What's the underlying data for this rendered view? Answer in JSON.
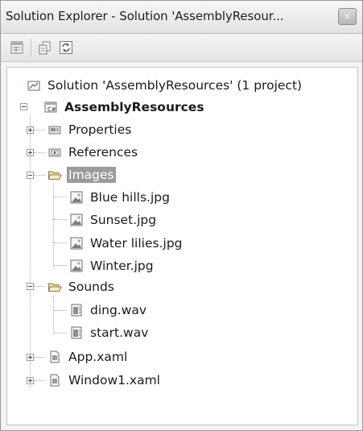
{
  "window": {
    "title": "Solution Explorer - Solution 'AssemblyResour...",
    "close_symbol": "✕"
  },
  "toolbar": {
    "buttons": [
      {
        "name": "properties-icon"
      },
      {
        "name": "show-all-files-icon"
      },
      {
        "name": "refresh-icon"
      }
    ]
  },
  "tree": {
    "solution": "Solution 'AssemblyResources' (1 project)",
    "project": "AssemblyResources",
    "properties": "Properties",
    "references": "References",
    "images": {
      "label": "Images",
      "files": [
        "Blue hills.jpg",
        "Sunset.jpg",
        "Water lilies.jpg",
        "Winter.jpg"
      ]
    },
    "sounds": {
      "label": "Sounds",
      "files": [
        "ding.wav",
        "start.wav"
      ]
    },
    "app": "App.xaml",
    "window1": "Window1.xaml"
  },
  "colors": {
    "selection": "#9b9b9b",
    "folder": "#f0d79a",
    "tree_lines": "#a8a8a8"
  }
}
